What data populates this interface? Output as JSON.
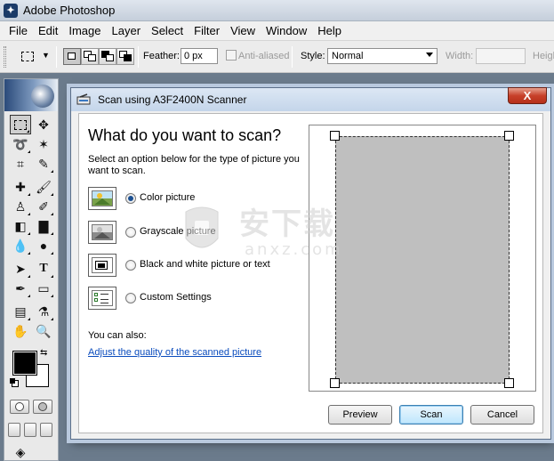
{
  "app": {
    "title": "Adobe Photoshop",
    "icon": "photoshop-icon"
  },
  "menu": [
    "File",
    "Edit",
    "Image",
    "Layer",
    "Select",
    "Filter",
    "View",
    "Window",
    "Help"
  ],
  "options": {
    "feather_label": "Feather:",
    "feather_value": "0 px",
    "antialiased_label": "Anti-aliased",
    "style_label": "Style:",
    "style_value": "Normal",
    "width_label": "Width:",
    "height_label": "Heigh"
  },
  "dialog": {
    "title": "Scan using A3F2400N Scanner",
    "close_glyph": "X",
    "heading": "What do you want to scan?",
    "description": "Select an option below for the type of picture you want to scan.",
    "options": [
      {
        "label": "Color picture",
        "icon": "color-picture-icon",
        "checked": true
      },
      {
        "label": "Grayscale picture",
        "icon": "grayscale-picture-icon",
        "checked": false
      },
      {
        "label": "Black and white picture or text",
        "icon": "bw-picture-icon",
        "checked": false
      },
      {
        "label": "Custom Settings",
        "icon": "custom-settings-icon",
        "checked": false
      }
    ],
    "also_label": "You can also:",
    "adjust_link": "Adjust the quality of the scanned picture",
    "buttons": {
      "preview": "Preview",
      "scan": "Scan",
      "cancel": "Cancel"
    }
  },
  "watermark": {
    "cn_text": "安下载",
    "latin_text": "anxz.com"
  },
  "colors": {
    "preview_gray": "#bfbfbf",
    "link": "#0b4cbd",
    "titlebar": "#c4d5ea"
  }
}
